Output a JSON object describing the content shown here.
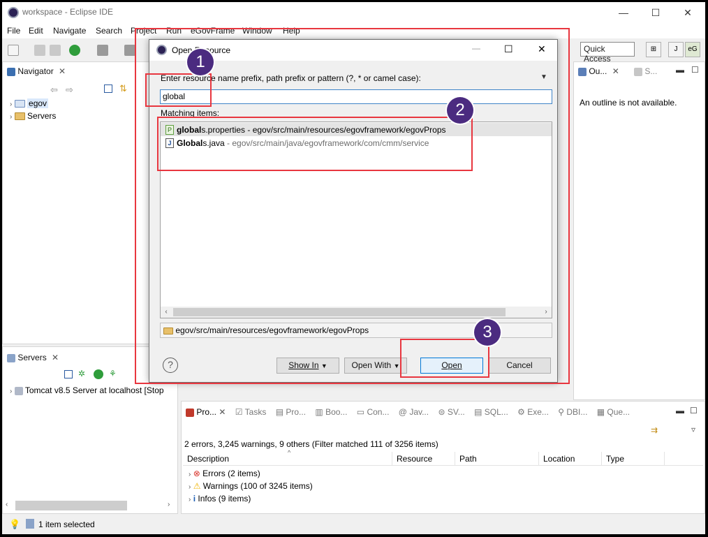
{
  "window": {
    "title": "workspace - Eclipse IDE",
    "minimize": "—",
    "maximize": "☐",
    "close": "✕"
  },
  "menu": [
    "File",
    "Edit",
    "Navigate",
    "Search",
    "Project",
    "Run",
    "eGovFrame",
    "Window",
    "Help"
  ],
  "toolbar": {
    "quick_access": "Quick Access"
  },
  "navigator": {
    "title": "Navigator",
    "items": [
      {
        "label": "egov"
      },
      {
        "label": "Servers"
      }
    ]
  },
  "outline": {
    "tab1": "Ou...",
    "tab2": "S...",
    "message": "An outline is not available."
  },
  "servers": {
    "title": "Servers",
    "row": "Tomcat v8.5 Server at localhost  [Stop"
  },
  "problems": {
    "tabs": [
      "Pro...",
      "Tasks",
      "Pro...",
      "Boo...",
      "Con...",
      "Jav...",
      "SV...",
      "SQL...",
      "Exe...",
      "DBI...",
      "Que..."
    ],
    "summary": "2 errors, 3,245 warnings, 9 others (Filter matched 111 of 3256 items)",
    "columns": [
      "Description",
      "Resource",
      "Path",
      "Location",
      "Type"
    ],
    "rows": [
      {
        "label": "Errors (2 items)",
        "color": "#d9342b"
      },
      {
        "label": "Warnings (100 of 3245 items)",
        "color": "#f0b400"
      },
      {
        "label": "Infos (9 items)",
        "color": "#1e5fb4"
      }
    ]
  },
  "status": {
    "text": "1 item selected"
  },
  "dialog": {
    "title": "Open Resource",
    "prompt": "Enter resource name prefix, path prefix or pattern (?, * or camel case):",
    "input_value": "global",
    "matching_label": "Matching items:",
    "items": [
      {
        "bold": "global",
        "rest": "s.properties",
        "path": " - egov/src/main/resources/egovframework/egovProps",
        "icon": "P"
      },
      {
        "bold": "Global",
        "rest": "s.java",
        "path": " - egov/src/main/java/egovframework/com/cmm/service",
        "icon": "J"
      }
    ],
    "footer_path": "egov/src/main/resources/egovframework/egovProps",
    "buttons": {
      "show_in": "Show In",
      "open_with": "Open With",
      "open": "Open",
      "cancel": "Cancel"
    },
    "help": "?"
  },
  "annotations": {
    "badge1": "1",
    "badge2": "2",
    "badge3": "3",
    "highlight": "#e8363f"
  }
}
